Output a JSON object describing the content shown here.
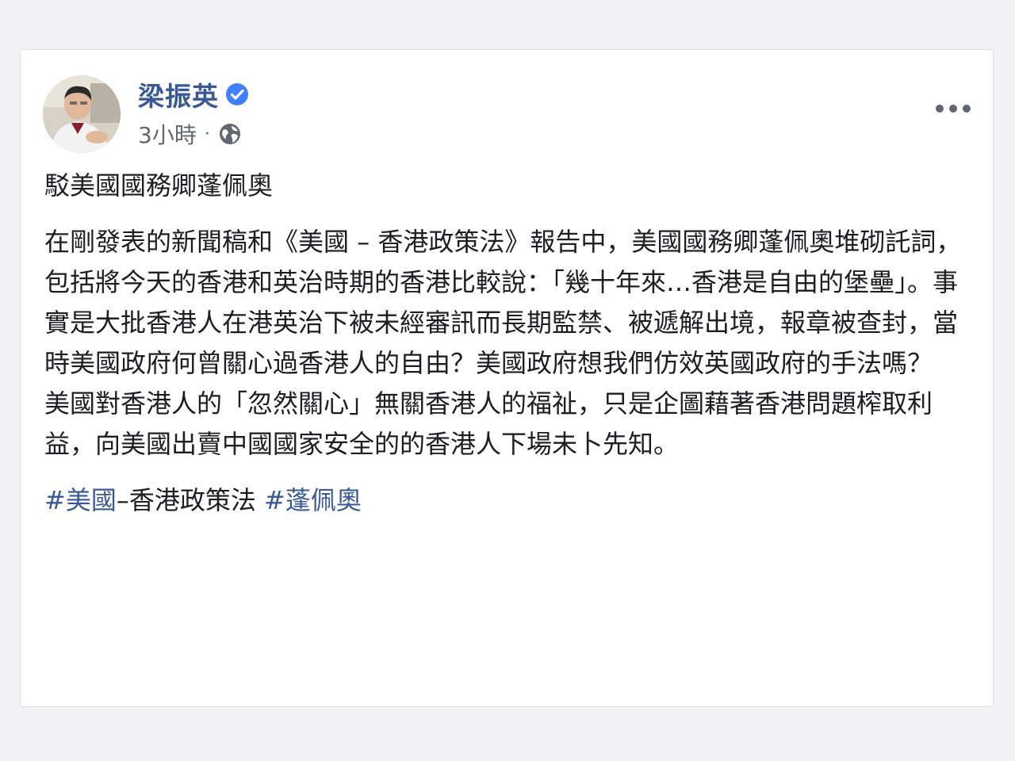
{
  "post": {
    "author": "梁振英",
    "time": "3小時",
    "separator": "·",
    "privacy_icon": "globe-icon",
    "verified_icon": "verified-badge-icon",
    "menu_icon": "more-options-icon",
    "title": "駁美國國務卿蓬佩奧",
    "paragraph_1": "在剛發表的新聞稿和《美國 – 香港政策法》報告中，美國國務卿蓬佩奧堆砌託詞，包括將今天的香港和英治時期的香港比較說：「幾十年來…香港是自由的堡壘」。事實是大批香港人在港英治下被未經審訊而長期監禁、被遞解出境，報章被查封，當時美國政府何曾關心過香港人的自由？美國政府想我們仿效英國政府的手法嗎？",
    "paragraph_2": "美國對香港人的「忽然關心」無關香港人的福祉，只是企圖藉著香港問題榨取利益，向美國出賣中國國家安全的的香港人下場未卜先知。",
    "hashtags": {
      "tag1_link": "#美國",
      "tag1_rest": "–香港政策法",
      "tag2_link": "#蓬佩奧"
    }
  },
  "colors": {
    "link": "#385898",
    "text": "#1c1e21",
    "meta": "#606770",
    "verified": "#4080ff"
  }
}
